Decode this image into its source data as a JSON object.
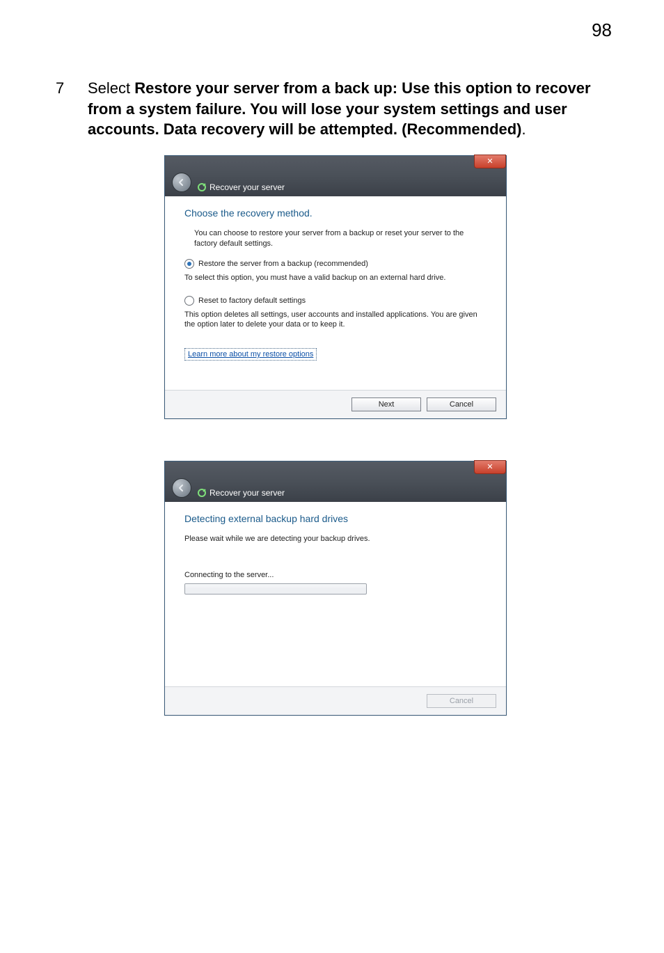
{
  "page_number": "98",
  "step": {
    "number": "7",
    "label_prefix": "Select ",
    "bold_text": "Restore your server from a back up: Use this option to recover from a system failure. You will lose your system settings and user accounts. Data recovery will be attempted. (Recommended)",
    "label_suffix": "."
  },
  "dialog1": {
    "close_glyph": "✕",
    "breadcrumb": "Recover your server",
    "title": "Choose the recovery method.",
    "intro": "You can choose to restore your server from a backup or reset your server to the factory default settings.",
    "option1_label": "Restore the server from a backup (recommended)",
    "option1_desc": "To select this option, you must have a valid backup on an external hard drive.",
    "option2_label": "Reset to factory default settings",
    "option2_desc": "This option deletes all settings, user accounts and installed applications. You are given the option later to delete your data or to keep it.",
    "learn_more": "Learn more about my restore options",
    "next": "Next",
    "cancel": "Cancel"
  },
  "dialog2": {
    "close_glyph": "✕",
    "breadcrumb": "Recover your server",
    "title": "Detecting external backup hard drives",
    "intro": "Please wait while we are detecting your backup drives.",
    "progress_label": "Connecting to the server...",
    "cancel": "Cancel"
  }
}
